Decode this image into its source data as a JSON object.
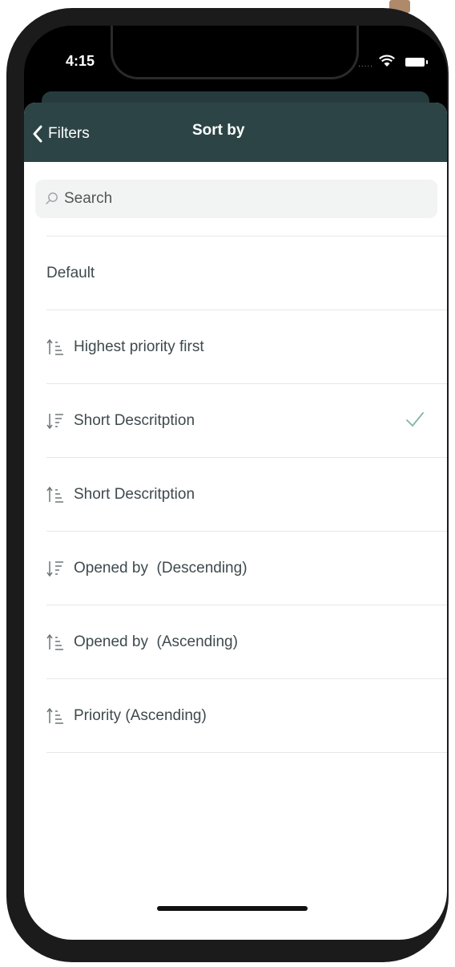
{
  "status_bar": {
    "time": "4:15",
    "signal": "....."
  },
  "nav": {
    "back_label": "Filters",
    "title": "Sort by"
  },
  "search": {
    "placeholder": "Search",
    "value": ""
  },
  "sort_options": [
    {
      "label": "Default",
      "icon": "none",
      "selected": false
    },
    {
      "label": "Highest priority first",
      "icon": "sort-ascending-icon",
      "selected": false
    },
    {
      "label": "Short Descritption",
      "icon": "sort-descending-icon",
      "selected": true
    },
    {
      "label": "Short Descritption",
      "icon": "sort-ascending-icon",
      "selected": false
    },
    {
      "label": "Opened by  (Descending)",
      "icon": "sort-descending-icon",
      "selected": false
    },
    {
      "label": "Opened by  (Ascending)",
      "icon": "sort-ascending-icon",
      "selected": false
    },
    {
      "label": "Priority (Ascending)",
      "icon": "sort-ascending-icon",
      "selected": false
    }
  ],
  "colors": {
    "nav_background": "#2d4446",
    "checkmark": "#7fb7a8",
    "text": "#3e4a4e"
  }
}
